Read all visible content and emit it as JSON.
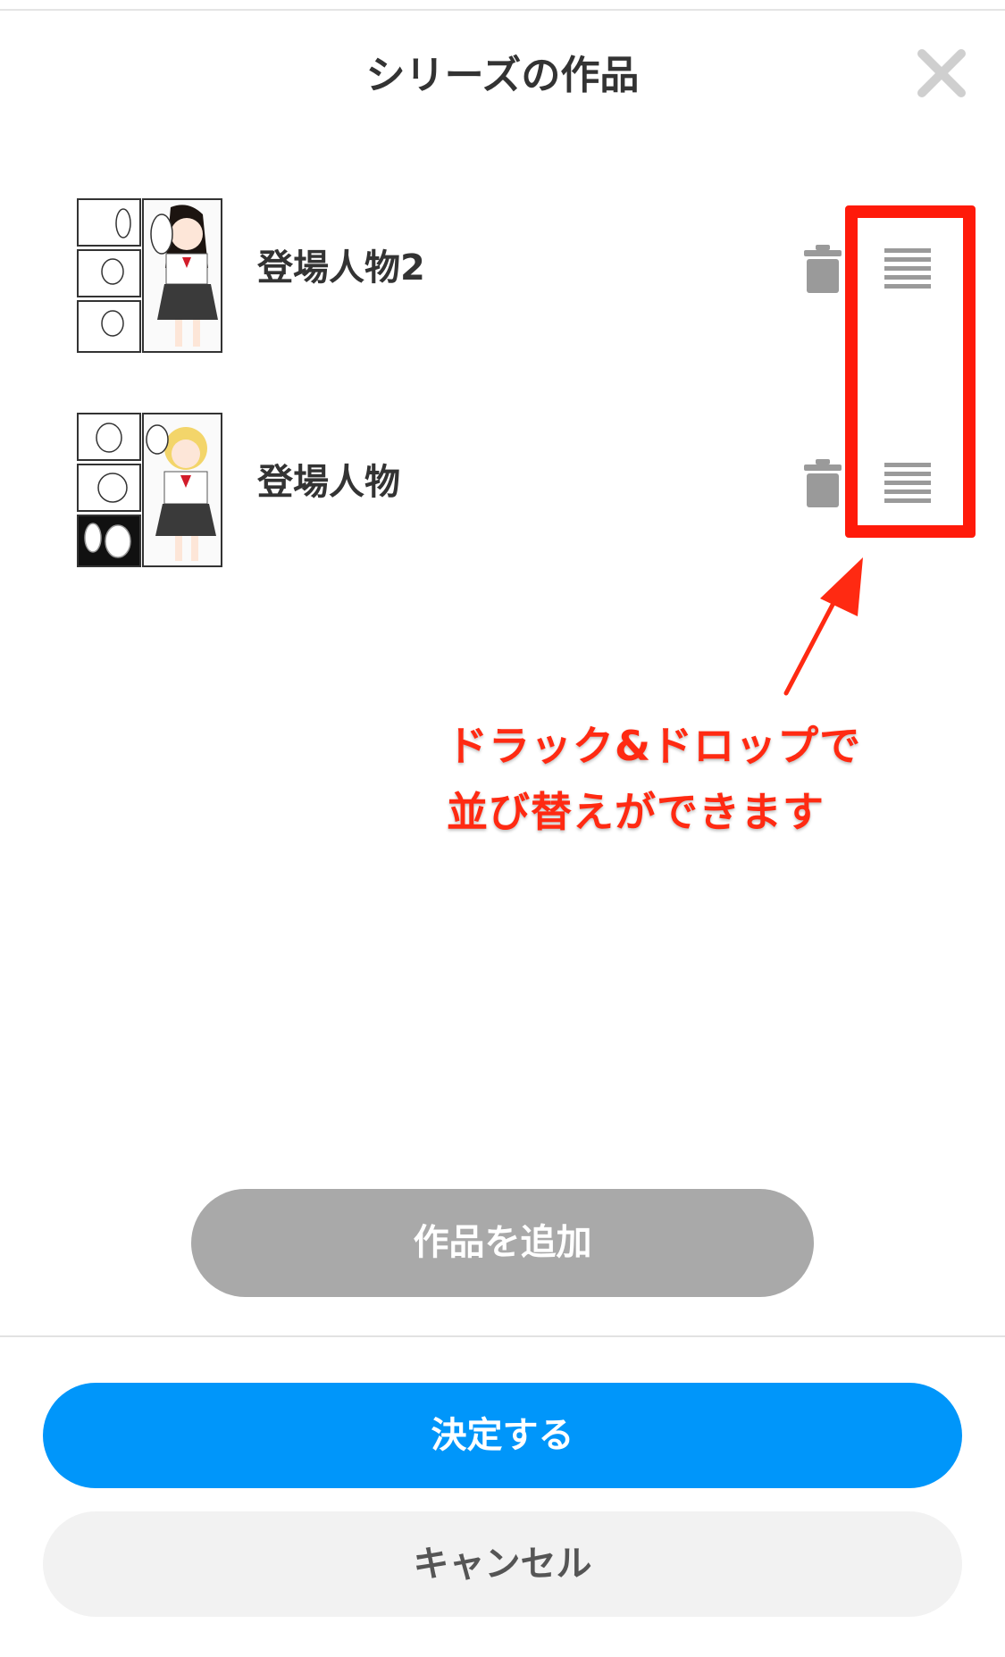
{
  "dialog": {
    "title": "シリーズの作品",
    "close_icon": "close-icon"
  },
  "works": [
    {
      "title": "登場人物2",
      "thumbnail_icon": "manga-thumbnail",
      "delete_icon": "trash-icon",
      "drag_icon": "drag-handle-icon"
    },
    {
      "title": "登場人物",
      "thumbnail_icon": "manga-thumbnail",
      "delete_icon": "trash-icon",
      "drag_icon": "drag-handle-icon"
    }
  ],
  "annotation": {
    "line1": "ドラック&ドロップで",
    "line2": "並び替えができます",
    "color": "#ff2a12"
  },
  "actions": {
    "add_label": "作品を追加",
    "confirm_label": "決定する",
    "cancel_label": "キャンセル"
  },
  "colors": {
    "primary": "#0096fa",
    "disabled": "#a9a9a9",
    "highlight": "#ff1a0a"
  }
}
